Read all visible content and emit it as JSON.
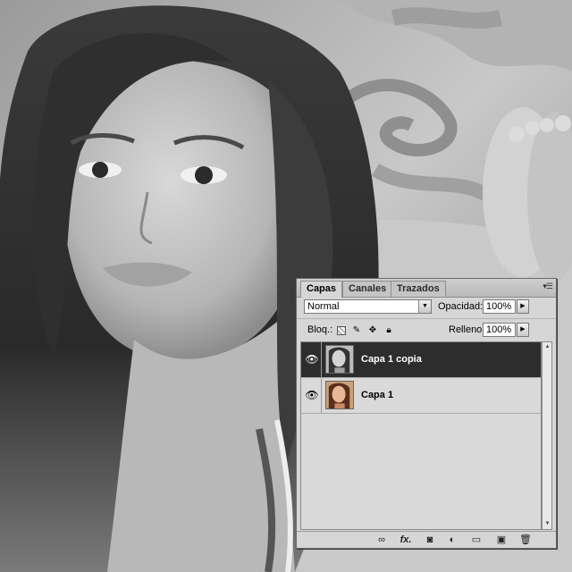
{
  "panel": {
    "tabs": [
      {
        "label": "Capas",
        "active": true
      },
      {
        "label": "Canales",
        "active": false
      },
      {
        "label": "Trazados",
        "active": false
      }
    ],
    "menu_icon": "panel-menu-icon",
    "blend_mode": "Normal",
    "opacity_label": "Opacidad:",
    "opacity_value": "100%",
    "lock_label": "Bloq.:",
    "lock_icons": [
      "lock-transparency-icon",
      "lock-pixels-icon",
      "lock-position-icon",
      "lock-all-icon"
    ],
    "fill_label": "Relleno:",
    "fill_value": "100%",
    "layers": [
      {
        "name": "Capa 1 copia",
        "selected": true,
        "visible": true,
        "thumbnail": "grayscale"
      },
      {
        "name": "Capa 1",
        "selected": false,
        "visible": true,
        "thumbnail": "color"
      }
    ],
    "footer_icons": [
      "link-layers-icon",
      "fx-icon",
      "add-mask-icon",
      "adjustment-layer-icon",
      "new-group-icon",
      "new-layer-icon",
      "trash-icon"
    ],
    "footer_fx_label": "fx."
  },
  "colors": {
    "selected_row": "#2d2d2d",
    "panel_bg": "#d6d6d6"
  }
}
